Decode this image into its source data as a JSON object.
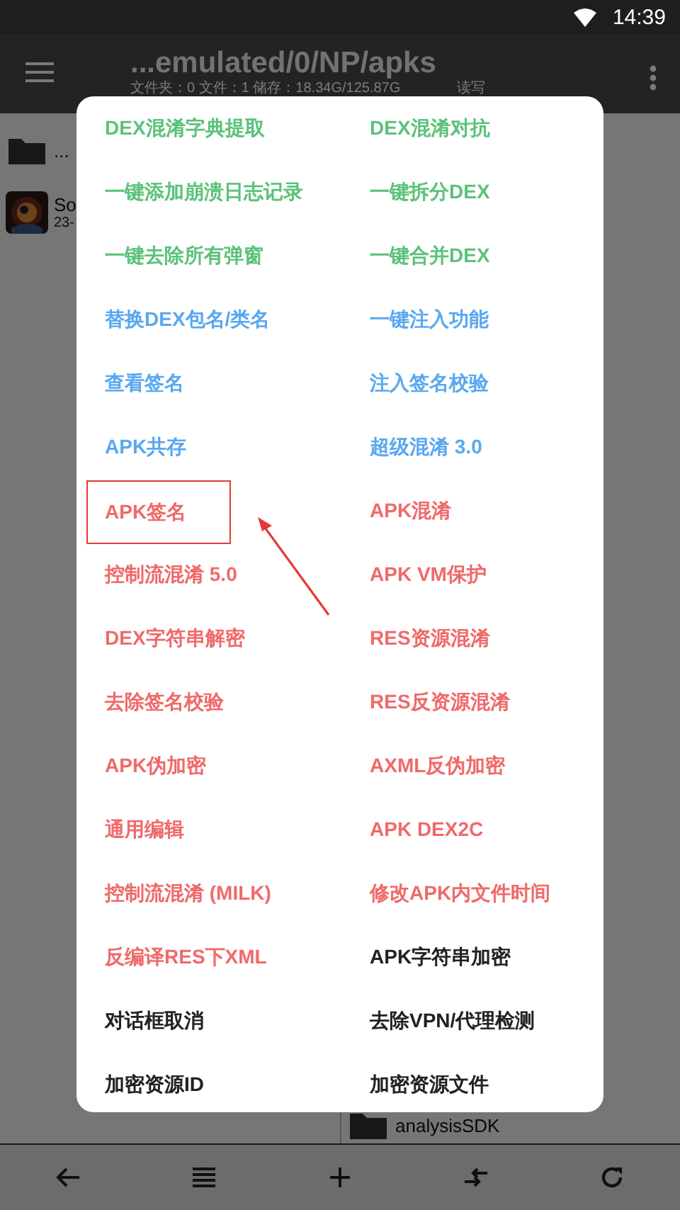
{
  "status_bar": {
    "time": "14:39"
  },
  "toolbar": {
    "title": "...emulated/0/NP/apks",
    "subtitle": "文件夹：0  文件：1  储存：18.34G/125.87G",
    "mode": "读写"
  },
  "left_panel": {
    "items": [
      {
        "kind": "folder",
        "name": "..."
      },
      {
        "kind": "app",
        "name": "So",
        "detail": "23-"
      }
    ]
  },
  "right_panel": {
    "items": [
      {
        "kind": "folder",
        "name": "analysisSDK"
      }
    ]
  },
  "dialog": {
    "items": [
      {
        "label": "DEX混淆字典提取",
        "color": "#5cc27a",
        "highlighted": false
      },
      {
        "label": "DEX混淆对抗",
        "color": "#5cc27a",
        "highlighted": false
      },
      {
        "label": "一键添加崩溃日志记录",
        "color": "#5cc27a",
        "highlighted": false
      },
      {
        "label": "一键拆分DEX",
        "color": "#5cc27a",
        "highlighted": false
      },
      {
        "label": "一键去除所有弹窗",
        "color": "#5cc27a",
        "highlighted": false
      },
      {
        "label": "一键合并DEX",
        "color": "#5cc27a",
        "highlighted": false
      },
      {
        "label": "替换DEX包名/类名",
        "color": "#5aa8f0",
        "highlighted": false
      },
      {
        "label": "一键注入功能",
        "color": "#5aa8f0",
        "highlighted": false
      },
      {
        "label": "查看签名",
        "color": "#5aa8f0",
        "highlighted": false
      },
      {
        "label": "注入签名校验",
        "color": "#5aa8f0",
        "highlighted": false
      },
      {
        "label": "APK共存",
        "color": "#5aa8f0",
        "highlighted": false
      },
      {
        "label": "超级混淆 3.0",
        "color": "#5aa8f0",
        "highlighted": false
      },
      {
        "label": "APK签名",
        "color": "#f06a6a",
        "highlighted": true
      },
      {
        "label": "APK混淆",
        "color": "#f06a6a",
        "highlighted": false
      },
      {
        "label": "控制流混淆 5.0",
        "color": "#f06a6a",
        "highlighted": false
      },
      {
        "label": "APK VM保护",
        "color": "#f06a6a",
        "highlighted": false
      },
      {
        "label": "DEX字符串解密",
        "color": "#f06a6a",
        "highlighted": false
      },
      {
        "label": "RES资源混淆",
        "color": "#f06a6a",
        "highlighted": false
      },
      {
        "label": "去除签名校验",
        "color": "#f06a6a",
        "highlighted": false
      },
      {
        "label": "RES反资源混淆",
        "color": "#f06a6a",
        "highlighted": false
      },
      {
        "label": "APK伪加密",
        "color": "#f06a6a",
        "highlighted": false
      },
      {
        "label": "AXML反伪加密",
        "color": "#f06a6a",
        "highlighted": false
      },
      {
        "label": "通用编辑",
        "color": "#f06a6a",
        "highlighted": false
      },
      {
        "label": "APK DEX2C",
        "color": "#f06a6a",
        "highlighted": false
      },
      {
        "label": "控制流混淆 (MILK)",
        "color": "#f06a6a",
        "highlighted": false
      },
      {
        "label": "修改APK内文件时间",
        "color": "#f06a6a",
        "highlighted": false
      },
      {
        "label": "反编译RES下XML",
        "color": "#f06a6a",
        "highlighted": false
      },
      {
        "label": "APK字符串加密",
        "color": "#222222",
        "highlighted": false
      },
      {
        "label": "对话框取消",
        "color": "#222222",
        "highlighted": false
      },
      {
        "label": "去除VPN/代理检测",
        "color": "#222222",
        "highlighted": false
      },
      {
        "label": "加密资源ID",
        "color": "#222222",
        "highlighted": false
      },
      {
        "label": "加密资源文件",
        "color": "#222222",
        "highlighted": false
      }
    ]
  }
}
